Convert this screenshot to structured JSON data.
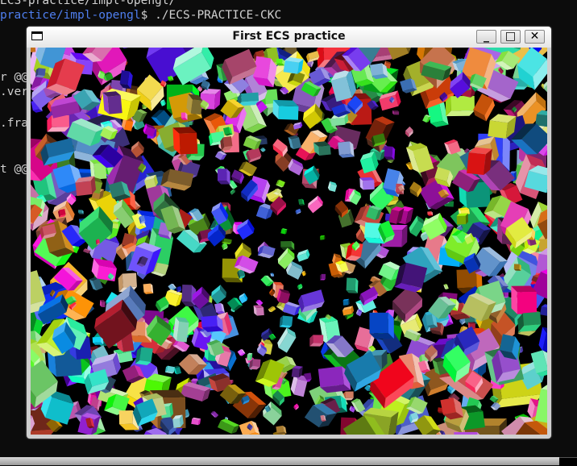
{
  "terminal": {
    "lines": [
      {
        "text": "ECS-practice/impl-opengl/"
      },
      {
        "prompt": "practice/impl-opengl",
        "command": "$ ./ECS-PRACTICE-CKC"
      },
      {
        "text": "r @@"
      },
      {
        "text": ".ver"
      },
      {
        "text": ".fra"
      },
      {
        "text": "t @@"
      }
    ]
  },
  "window": {
    "title": "First ECS practice",
    "minimize_label": "_",
    "maximize_label": "□",
    "close_label": "✕",
    "content": "Scene of many randomly rotated, randomly colored 3D cubes on a black background"
  }
}
